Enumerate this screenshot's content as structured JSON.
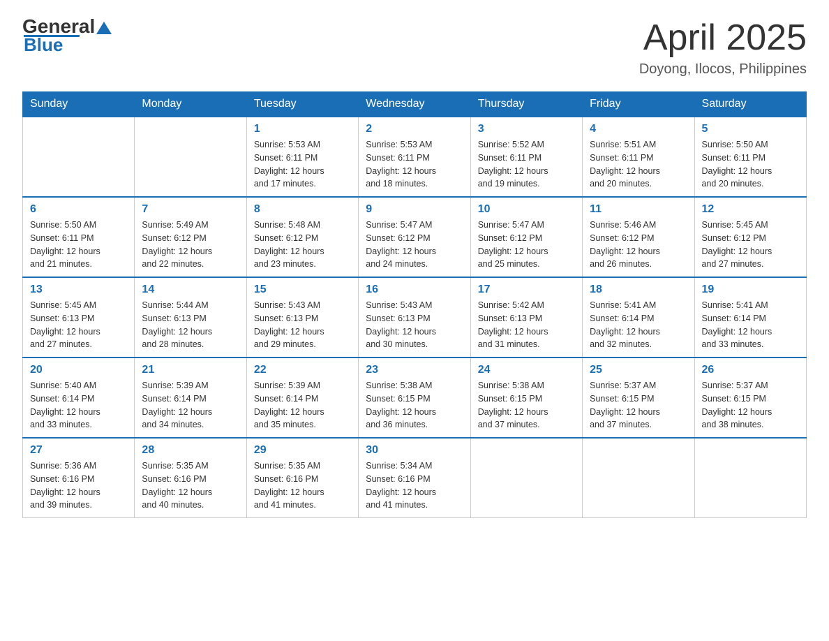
{
  "header": {
    "logo_general": "General",
    "logo_blue": "Blue",
    "month_title": "April 2025",
    "location": "Doyong, Ilocos, Philippines"
  },
  "days_of_week": [
    "Sunday",
    "Monday",
    "Tuesday",
    "Wednesday",
    "Thursday",
    "Friday",
    "Saturday"
  ],
  "weeks": [
    [
      {
        "day": "",
        "info": ""
      },
      {
        "day": "",
        "info": ""
      },
      {
        "day": "1",
        "info": "Sunrise: 5:53 AM\nSunset: 6:11 PM\nDaylight: 12 hours\nand 17 minutes."
      },
      {
        "day": "2",
        "info": "Sunrise: 5:53 AM\nSunset: 6:11 PM\nDaylight: 12 hours\nand 18 minutes."
      },
      {
        "day": "3",
        "info": "Sunrise: 5:52 AM\nSunset: 6:11 PM\nDaylight: 12 hours\nand 19 minutes."
      },
      {
        "day": "4",
        "info": "Sunrise: 5:51 AM\nSunset: 6:11 PM\nDaylight: 12 hours\nand 20 minutes."
      },
      {
        "day": "5",
        "info": "Sunrise: 5:50 AM\nSunset: 6:11 PM\nDaylight: 12 hours\nand 20 minutes."
      }
    ],
    [
      {
        "day": "6",
        "info": "Sunrise: 5:50 AM\nSunset: 6:11 PM\nDaylight: 12 hours\nand 21 minutes."
      },
      {
        "day": "7",
        "info": "Sunrise: 5:49 AM\nSunset: 6:12 PM\nDaylight: 12 hours\nand 22 minutes."
      },
      {
        "day": "8",
        "info": "Sunrise: 5:48 AM\nSunset: 6:12 PM\nDaylight: 12 hours\nand 23 minutes."
      },
      {
        "day": "9",
        "info": "Sunrise: 5:47 AM\nSunset: 6:12 PM\nDaylight: 12 hours\nand 24 minutes."
      },
      {
        "day": "10",
        "info": "Sunrise: 5:47 AM\nSunset: 6:12 PM\nDaylight: 12 hours\nand 25 minutes."
      },
      {
        "day": "11",
        "info": "Sunrise: 5:46 AM\nSunset: 6:12 PM\nDaylight: 12 hours\nand 26 minutes."
      },
      {
        "day": "12",
        "info": "Sunrise: 5:45 AM\nSunset: 6:12 PM\nDaylight: 12 hours\nand 27 minutes."
      }
    ],
    [
      {
        "day": "13",
        "info": "Sunrise: 5:45 AM\nSunset: 6:13 PM\nDaylight: 12 hours\nand 27 minutes."
      },
      {
        "day": "14",
        "info": "Sunrise: 5:44 AM\nSunset: 6:13 PM\nDaylight: 12 hours\nand 28 minutes."
      },
      {
        "day": "15",
        "info": "Sunrise: 5:43 AM\nSunset: 6:13 PM\nDaylight: 12 hours\nand 29 minutes."
      },
      {
        "day": "16",
        "info": "Sunrise: 5:43 AM\nSunset: 6:13 PM\nDaylight: 12 hours\nand 30 minutes."
      },
      {
        "day": "17",
        "info": "Sunrise: 5:42 AM\nSunset: 6:13 PM\nDaylight: 12 hours\nand 31 minutes."
      },
      {
        "day": "18",
        "info": "Sunrise: 5:41 AM\nSunset: 6:14 PM\nDaylight: 12 hours\nand 32 minutes."
      },
      {
        "day": "19",
        "info": "Sunrise: 5:41 AM\nSunset: 6:14 PM\nDaylight: 12 hours\nand 33 minutes."
      }
    ],
    [
      {
        "day": "20",
        "info": "Sunrise: 5:40 AM\nSunset: 6:14 PM\nDaylight: 12 hours\nand 33 minutes."
      },
      {
        "day": "21",
        "info": "Sunrise: 5:39 AM\nSunset: 6:14 PM\nDaylight: 12 hours\nand 34 minutes."
      },
      {
        "day": "22",
        "info": "Sunrise: 5:39 AM\nSunset: 6:14 PM\nDaylight: 12 hours\nand 35 minutes."
      },
      {
        "day": "23",
        "info": "Sunrise: 5:38 AM\nSunset: 6:15 PM\nDaylight: 12 hours\nand 36 minutes."
      },
      {
        "day": "24",
        "info": "Sunrise: 5:38 AM\nSunset: 6:15 PM\nDaylight: 12 hours\nand 37 minutes."
      },
      {
        "day": "25",
        "info": "Sunrise: 5:37 AM\nSunset: 6:15 PM\nDaylight: 12 hours\nand 37 minutes."
      },
      {
        "day": "26",
        "info": "Sunrise: 5:37 AM\nSunset: 6:15 PM\nDaylight: 12 hours\nand 38 minutes."
      }
    ],
    [
      {
        "day": "27",
        "info": "Sunrise: 5:36 AM\nSunset: 6:16 PM\nDaylight: 12 hours\nand 39 minutes."
      },
      {
        "day": "28",
        "info": "Sunrise: 5:35 AM\nSunset: 6:16 PM\nDaylight: 12 hours\nand 40 minutes."
      },
      {
        "day": "29",
        "info": "Sunrise: 5:35 AM\nSunset: 6:16 PM\nDaylight: 12 hours\nand 41 minutes."
      },
      {
        "day": "30",
        "info": "Sunrise: 5:34 AM\nSunset: 6:16 PM\nDaylight: 12 hours\nand 41 minutes."
      },
      {
        "day": "",
        "info": ""
      },
      {
        "day": "",
        "info": ""
      },
      {
        "day": "",
        "info": ""
      }
    ]
  ]
}
